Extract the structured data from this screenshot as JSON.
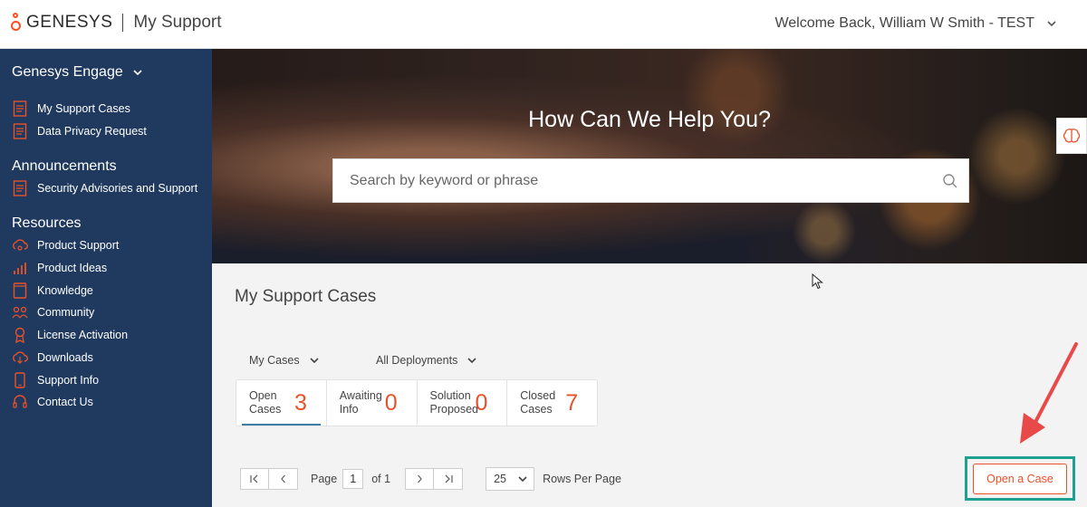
{
  "header": {
    "brand": "GENESYS",
    "app_name": "My Support",
    "welcome": "Welcome Back, William W Smith - TEST"
  },
  "sidebar": {
    "product": "Genesys Engage",
    "product_items": [
      {
        "label": "My Support Cases",
        "icon": "document-icon"
      },
      {
        "label": "Data Privacy Request",
        "icon": "document-icon"
      }
    ],
    "announcements_title": "Announcements",
    "announcement_items": [
      {
        "label": "Security Advisories and Support",
        "icon": "document-icon"
      }
    ],
    "resources_title": "Resources",
    "resource_items": [
      {
        "label": "Product Support",
        "icon": "cloud-support-icon"
      },
      {
        "label": "Product Ideas",
        "icon": "ideas-icon"
      },
      {
        "label": "Knowledge",
        "icon": "book-icon"
      },
      {
        "label": "Community",
        "icon": "community-icon"
      },
      {
        "label": "License Activation",
        "icon": "license-icon"
      },
      {
        "label": "Downloads",
        "icon": "cloud-download-icon"
      },
      {
        "label": "Support Info",
        "icon": "phone-icon"
      },
      {
        "label": "Contact Us",
        "icon": "headset-icon"
      }
    ]
  },
  "hero": {
    "title": "How Can We Help You?",
    "search_placeholder": "Search by keyword or phrase"
  },
  "main": {
    "title": "My Support Cases",
    "filter_cases": "My Cases",
    "filter_deployments": "All Deployments",
    "stats": [
      {
        "line1": "Open",
        "line2": "Cases",
        "count": "3",
        "active": true
      },
      {
        "line1": "Awaiting",
        "line2": "Info",
        "count": "0",
        "active": false
      },
      {
        "line1": "Solution",
        "line2": "Proposed",
        "count": "0",
        "active": false
      },
      {
        "line1": "Closed",
        "line2": "Cases",
        "count": "7",
        "active": false
      }
    ],
    "pager": {
      "page_label": "Page",
      "page_value": "1",
      "of_label": "of 1",
      "rows_value": "25",
      "rows_label": "Rows Per Page"
    },
    "open_case_label": "Open a Case"
  },
  "colors": {
    "accent": "#e8522a",
    "sidebar": "#203a5f",
    "highlight": "#1fa191",
    "arrow": "#e84a4a"
  }
}
